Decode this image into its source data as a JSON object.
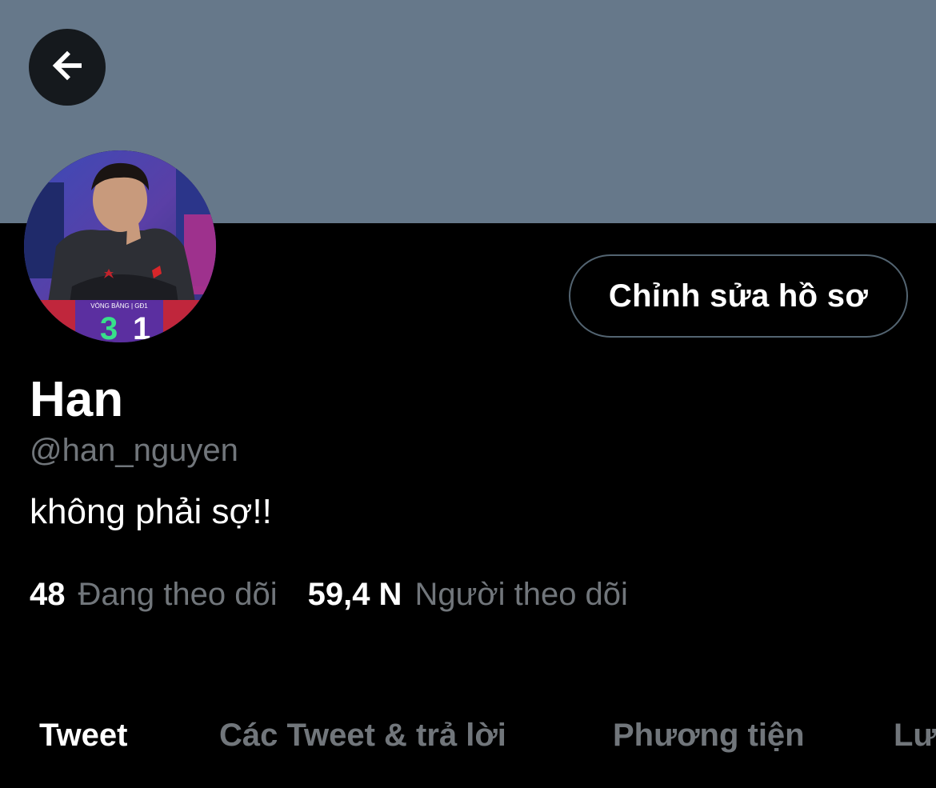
{
  "header": {
    "banner_color": "#66788a",
    "back_icon": "arrow-left-icon"
  },
  "profile": {
    "avatar_icon": "avatar-photo",
    "edit_button_label": "Chỉnh sửa hồ sơ",
    "display_name": "Han",
    "handle": "@han_nguyen",
    "bio": "không phải sợ!!",
    "following_count": "48",
    "following_label": "Đang theo dõi",
    "followers_count": "59,4 N",
    "followers_label": "Người theo dõi"
  },
  "tabs": [
    {
      "label": "Tweet",
      "active": true
    },
    {
      "label": "Các Tweet & trả lời",
      "active": false
    },
    {
      "label": "Phương tiện",
      "active": false
    },
    {
      "label": "Lư",
      "active": false
    }
  ],
  "colors": {
    "background": "#000000",
    "primary_text": "#ffffff",
    "secondary_text": "#71767b",
    "button_border": "#536471"
  }
}
